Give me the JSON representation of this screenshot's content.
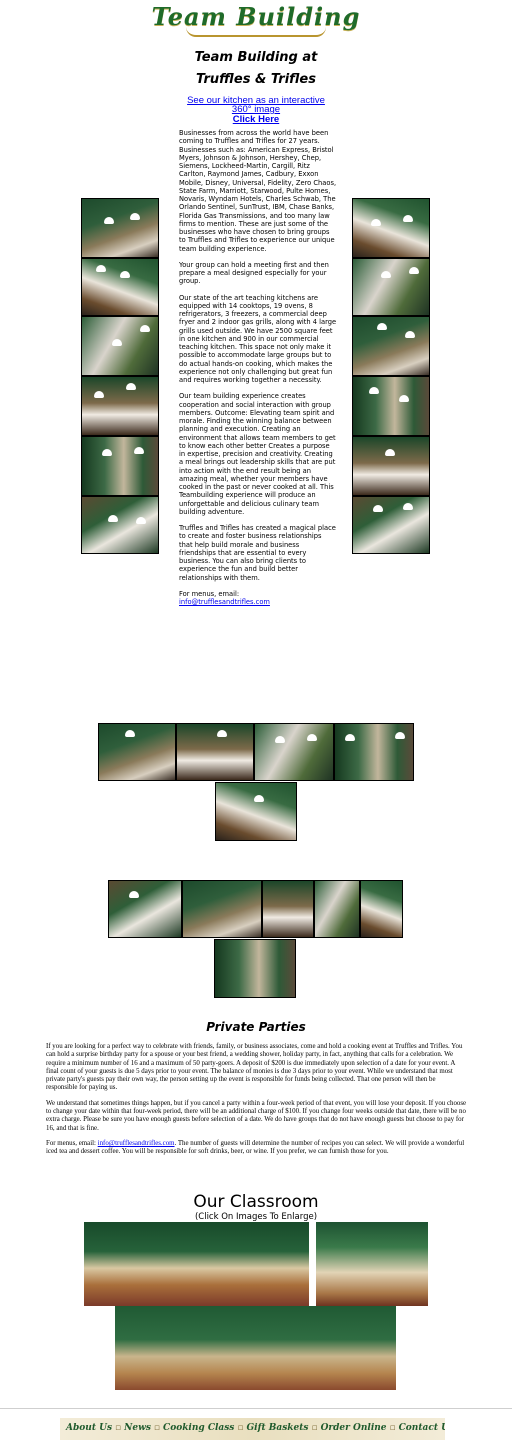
{
  "header": {
    "logo_text": "Team Building",
    "title_line1": "Team Building at",
    "title_line2": "Truffles & Trifles",
    "kitchen_link_line1": "See our kitchen as an interactive",
    "kitchen_link_line2": "360° image",
    "click_here": "Click Here"
  },
  "main": {
    "paragraphs": [
      "Businesses from across the world have been coming to Truffles and Trifles for 27 years. Businesses such as: American Express, Bristol Myers, Johnson & Johnson, Hershey, Chep, Siemens, Lockheed-Martin, Cargill, Ritz Carlton, Raymond James, Cadbury, Exxon Mobile, Disney, Universal, Fidelity, Zero Chaos, State Farm, Marriott, Starwood, Pulte Homes, Novaris, Wyndam Hotels, Charles Schwab, The Orlando Sentinel, SunTrust, IBM, Chase Banks, Florida Gas Transmissions, and too many law firms to mention. These are just some of the businesses who have chosen to bring groups to Truffles and Trifles to experience our unique team building experience.",
      "Your group can hold a meeting first and then prepare a meal designed especially for your group.",
      "Our state of the art teaching kitchens are equipped with 14 cooktops, 19 ovens, 8 refrigerators, 3 freezers, a commercial deep fryer and 2 indoor gas grills, along with 4 large grills used outside. We have 2500 square feet in one kitchen and 900 in our commercial teaching kitchen. This space not only make it possible to accommodate large groups but to do actual hands-on cooking, which makes the experience not only challenging but great fun and requires working together a necessity.",
      "Our team building experience creates cooperation and social interaction with group members. Outcome: Elevating team spirit and morale. Finding the winning balance between planning and execution. Creating an environment that allows team members to get to know each other better Creates a purpose in expertise, precision and creativity. Creating a meal brings out leadership skills that are put into action with the end result being an amazing meal, whether your members have cooked in the past or never cooked at all. This Teambuilding experience will produce an unforgettable and delicious culinary team building adventure.",
      "Truffles and Trifles has created a magical place to create and foster business relationships that help build morale and business friendships that are essential to every business. You can also bring clients to experience the fun and build better relationships with them."
    ],
    "menus_label": "For menus, email:",
    "menus_email": "info@trufflesandtrifles.com"
  },
  "private_parties": {
    "title": "Private Parties",
    "p1": "If you are looking for a perfect way to celebrate with friends, family, or business associates, come and hold a cooking event at Truffles and Trifles.  You can hold a surprise birthday party for a spouse or your best friend, a wedding shower, holiday party, in fact, anything that calls for a celebration.  We require a minimum number of 16 and a maximum of 50 party-goers.  A deposit of $200 is due immediately upon selection of a date for your event.  A final count of your guests is due 5 days prior to your event.  The balance of monies is due 3 days prior to your event.  While we understand that most private party's guests pay their own way, the person setting up the event is responsible for funds being collected.  That one person will then be responsible for paying us.",
    "p2": "We understand that sometimes things happen, but if you cancel a party within a four-week period of that event, you will lose your deposit.  If you choose to change your date within that four-week period, there will be an additional charge of $100.  If you change four weeks outside that date, there will be no extra charge.  Please be sure you have enough guests before selection of a date.  We do have groups that do not have enough guests but choose to pay for 16, and that is fine.",
    "p3_prefix": "For menus, email: ",
    "p3_email": "info@trufflesandtrifles.com",
    "p3_suffix": ". The number of guests will determine the number of recipes you can select.  We will provide a wonderful iced tea and dessert coffee.  You will be responsible for soft drinks, beer, or wine.  If you prefer, we can furnish those for you."
  },
  "classroom": {
    "title": "Our Classroom",
    "subtitle": "(Click On Images To Enlarge)"
  },
  "nav": {
    "items": [
      "About Us",
      "News",
      "Cooking Class",
      "Gift Baskets",
      "Order Online",
      "Contact Us"
    ],
    "separator": "▫"
  }
}
